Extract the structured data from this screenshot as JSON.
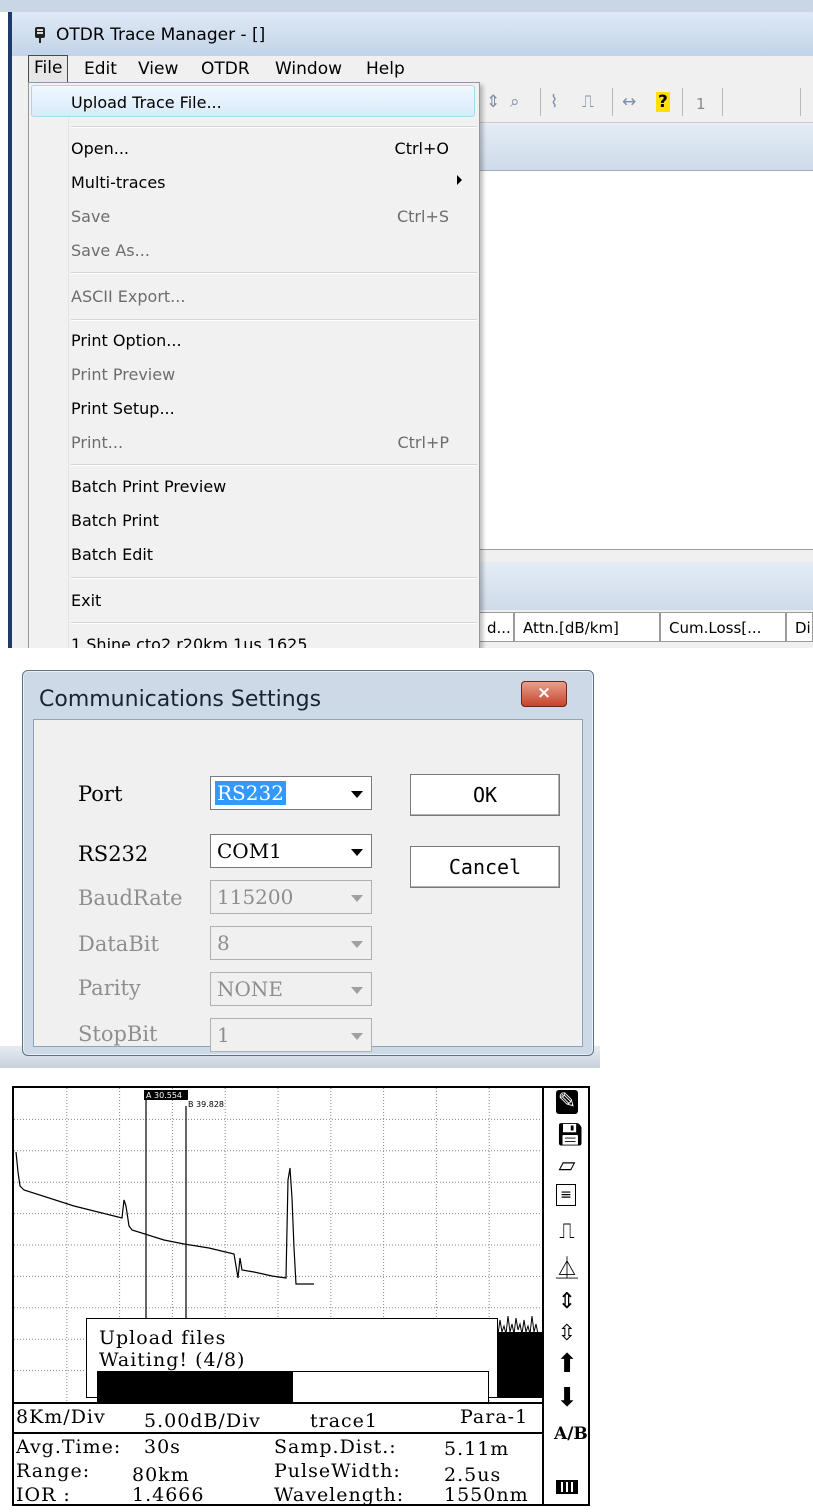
{
  "app": {
    "title": "OTDR Trace Manager - []",
    "menubar": [
      "File",
      "Edit",
      "View",
      "OTDR",
      "Window",
      "Help"
    ],
    "toolbar_page": "1",
    "column_headers": [
      "d...",
      "Attn.[dB/km]",
      "Cum.Loss[...",
      "Di"
    ],
    "file_menu": {
      "items": [
        {
          "label": "Upload Trace File...",
          "shortcut": "",
          "enabled": true,
          "highlighted": true
        },
        {
          "label": "Open...",
          "shortcut": "Ctrl+O",
          "enabled": true
        },
        {
          "label": "Multi-traces",
          "shortcut": "",
          "enabled": true,
          "submenu": true
        },
        {
          "label": "Save",
          "shortcut": "Ctrl+S",
          "enabled": false
        },
        {
          "label": "Save As...",
          "shortcut": "",
          "enabled": false
        },
        {
          "label": "ASCII Export...",
          "shortcut": "",
          "enabled": false
        },
        {
          "label": "Print Option...",
          "shortcut": "",
          "enabled": true
        },
        {
          "label": "Print Preview",
          "shortcut": "",
          "enabled": false
        },
        {
          "label": "Print Setup...",
          "shortcut": "",
          "enabled": true
        },
        {
          "label": "Print...",
          "shortcut": "Ctrl+P",
          "enabled": false
        },
        {
          "label": "Batch Print Preview",
          "shortcut": "",
          "enabled": true
        },
        {
          "label": "Batch Print",
          "shortcut": "",
          "enabled": true
        },
        {
          "label": "Batch Edit",
          "shortcut": "",
          "enabled": true
        },
        {
          "label": "Exit",
          "shortcut": "",
          "enabled": true
        },
        {
          "label": "1 Shine cto2 r20km 1us 1625",
          "shortcut": "",
          "enabled": true
        }
      ]
    }
  },
  "comm_dialog": {
    "title": "Communications Settings",
    "close_glyph": "×",
    "fields": [
      {
        "label": "Port",
        "value": "RS232",
        "enabled": true,
        "selected": true
      },
      {
        "label": "RS232",
        "value": "COM1",
        "enabled": true
      },
      {
        "label": "BaudRate",
        "value": "115200",
        "enabled": false
      },
      {
        "label": "DataBit",
        "value": "8",
        "enabled": false
      },
      {
        "label": "Parity",
        "value": "NONE",
        "enabled": false
      },
      {
        "label": "StopBit",
        "value": "1",
        "enabled": false
      }
    ],
    "ok_label": "OK",
    "cancel_label": "Cancel"
  },
  "device_screen": {
    "marker_a": "A 30.554",
    "marker_b": "B 39.828",
    "upload_title": "Upload files",
    "upload_status": "Waiting! (4/8)",
    "upload_progress": 0.5,
    "status_line": {
      "scale_x": "8Km/Div",
      "scale_y": "5.00dB/Div",
      "trace": "trace1",
      "para": "Para-1"
    },
    "params": {
      "avg_time_label": "Avg.Time:",
      "avg_time_value": "30s",
      "range_label": "Range:",
      "range_value": "80km",
      "ior_label": "IOR :",
      "ior_value": "1.4666",
      "samp_label": "Samp.Dist.:",
      "samp_value": "5.11m",
      "pulse_label": "PulseWidth:",
      "pulse_value": "2.5us",
      "wave_label": "Wavelength:",
      "wave_value": "1550nm"
    },
    "ab_label": "A/B",
    "side_icons": [
      "wrench-icon",
      "save-icon",
      "open-folder-icon",
      "upload-list-icon",
      "pulse-expand-icon",
      "pulse-compress-icon",
      "pulse-vertical-icon",
      "pulse-zoom-icon",
      "arrow-up-icon",
      "arrow-down-icon",
      "ab-marker-icon",
      "battery-icon"
    ]
  }
}
